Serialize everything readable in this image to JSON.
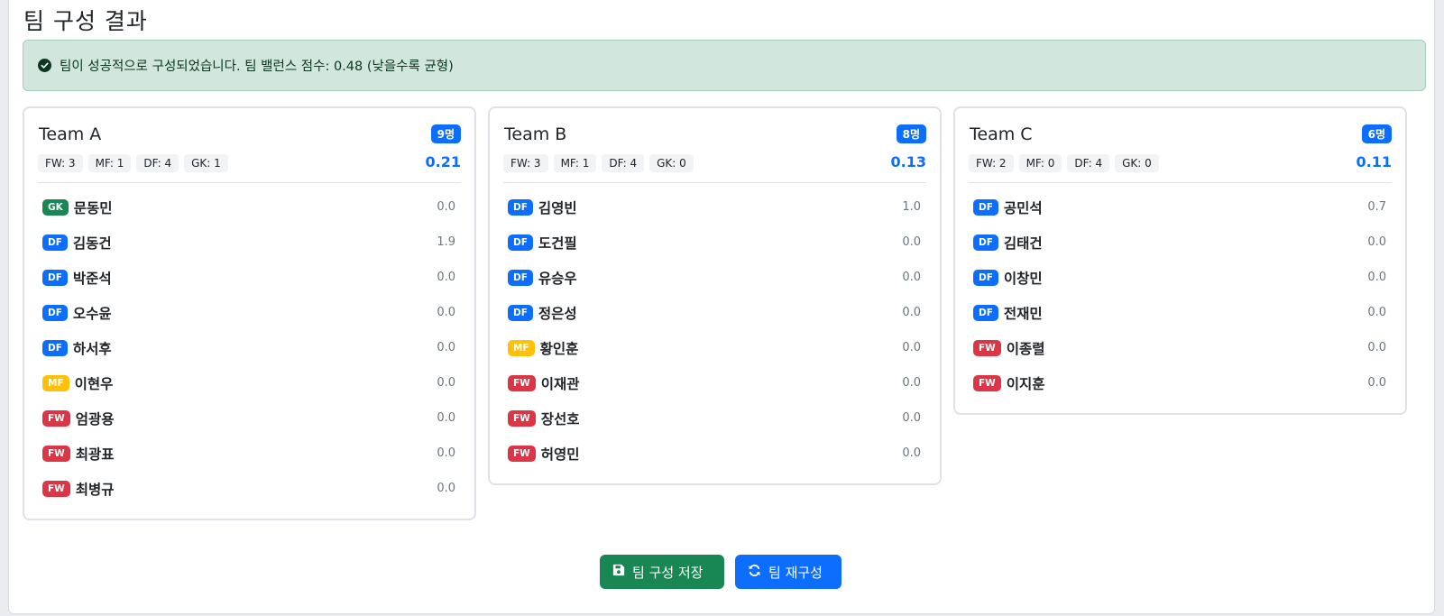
{
  "title": "팀 구성 결과",
  "alert": {
    "icon": "check-circle-icon",
    "text": "팀이 성공적으로 구성되었습니다. 팀 밸런스 점수: 0.48 (낮을수록 균형)"
  },
  "teams": [
    {
      "name": "Team A",
      "count": "9명",
      "score": "0.21",
      "positions": [
        "FW: 3",
        "MF: 1",
        "DF: 4",
        "GK: 1"
      ],
      "players": [
        {
          "pos": "GK",
          "name": "문동민",
          "value": "0.0"
        },
        {
          "pos": "DF",
          "name": "김동건",
          "value": "1.9"
        },
        {
          "pos": "DF",
          "name": "박준석",
          "value": "0.0"
        },
        {
          "pos": "DF",
          "name": "오수윤",
          "value": "0.0"
        },
        {
          "pos": "DF",
          "name": "하서후",
          "value": "0.0"
        },
        {
          "pos": "MF",
          "name": "이현우",
          "value": "0.0"
        },
        {
          "pos": "FW",
          "name": "엄광용",
          "value": "0.0"
        },
        {
          "pos": "FW",
          "name": "최광표",
          "value": "0.0"
        },
        {
          "pos": "FW",
          "name": "최병규",
          "value": "0.0"
        }
      ]
    },
    {
      "name": "Team B",
      "count": "8명",
      "score": "0.13",
      "positions": [
        "FW: 3",
        "MF: 1",
        "DF: 4",
        "GK: 0"
      ],
      "players": [
        {
          "pos": "DF",
          "name": "김영빈",
          "value": "1.0"
        },
        {
          "pos": "DF",
          "name": "도건필",
          "value": "0.0"
        },
        {
          "pos": "DF",
          "name": "유승우",
          "value": "0.0"
        },
        {
          "pos": "DF",
          "name": "정은성",
          "value": "0.0"
        },
        {
          "pos": "MF",
          "name": "황인훈",
          "value": "0.0"
        },
        {
          "pos": "FW",
          "name": "이재관",
          "value": "0.0"
        },
        {
          "pos": "FW",
          "name": "장선호",
          "value": "0.0"
        },
        {
          "pos": "FW",
          "name": "허영민",
          "value": "0.0"
        }
      ]
    },
    {
      "name": "Team C",
      "count": "6명",
      "score": "0.11",
      "positions": [
        "FW: 2",
        "MF: 0",
        "DF: 4",
        "GK: 0"
      ],
      "players": [
        {
          "pos": "DF",
          "name": "공민석",
          "value": "0.7"
        },
        {
          "pos": "DF",
          "name": "김태건",
          "value": "0.0"
        },
        {
          "pos": "DF",
          "name": "이창민",
          "value": "0.0"
        },
        {
          "pos": "DF",
          "name": "전재민",
          "value": "0.0"
        },
        {
          "pos": "FW",
          "name": "이종렬",
          "value": "0.0"
        },
        {
          "pos": "FW",
          "name": "이지훈",
          "value": "0.0"
        }
      ]
    }
  ],
  "buttons": {
    "save": {
      "label": "팀 구성 저장",
      "icon": "save-icon"
    },
    "rebuild": {
      "label": "팀 재구성",
      "icon": "refresh-icon"
    }
  },
  "colors": {
    "GK": "#198754",
    "DF": "#0d6efd",
    "MF": "#ffc107",
    "FW": "#dc3545",
    "primary": "#0d6efd",
    "success": "#198754"
  }
}
